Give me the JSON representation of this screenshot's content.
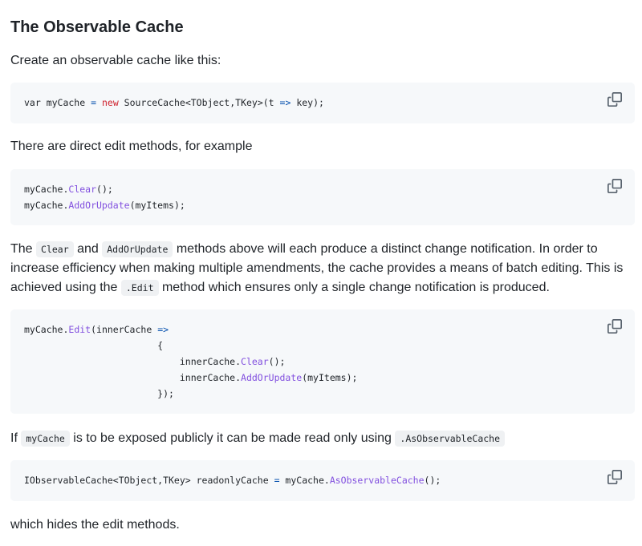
{
  "heading": "The Observable Cache",
  "p1": "Create an observable cache like this:",
  "p2": "There are direct edit methods, for example",
  "p3": {
    "t1": "The ",
    "c1": "Clear",
    "t2": " and ",
    "c2": "AddOrUpdate",
    "t3": " methods above will each produce a distinct change notification. In order to increase efficiency when making multiple amendments, the cache provides a means of batch editing. This is achieved using the ",
    "c3": ".Edit",
    "t4": " method which ensures only a single change notification is produced."
  },
  "p4": {
    "t1": "If ",
    "c1": "myCache",
    "t2": " is to be exposed publicly it can be made read only using ",
    "c2": ".AsObservableCache"
  },
  "p5": "which hides the edit methods.",
  "code1": {
    "l1": {
      "a": "var myCache ",
      "b": "=",
      "c": " ",
      "d": "new",
      "e": " SourceCache<TObject,TKey>(t ",
      "f": "=>",
      "g": " key);"
    }
  },
  "code2": {
    "l1": {
      "a": "myCache.",
      "b": "Clear",
      "c": "();"
    },
    "l2": {
      "a": "myCache.",
      "b": "AddOrUpdate",
      "c": "(myItems);"
    }
  },
  "code3": {
    "l1": {
      "a": "myCache.",
      "b": "Edit",
      "c": "(innerCache ",
      "d": "=>"
    },
    "l2": "                        {",
    "l3": {
      "a": "                            innerCache.",
      "b": "Clear",
      "c": "();"
    },
    "l4": {
      "a": "                            innerCache.",
      "b": "AddOrUpdate",
      "c": "(myItems);"
    },
    "l5": "                        });"
  },
  "code4": {
    "l1": {
      "a": "IObservableCache<TObject,TKey> readonlyCache ",
      "b": "=",
      "c": " myCache.",
      "d": "AsObservableCache",
      "e": "();"
    }
  },
  "colors": {
    "keyword": "#cf222e",
    "method": "#8250df",
    "operator": "#0550ae",
    "code_bg": "#f6f8fa"
  },
  "icons": {
    "copy": "copy-icon"
  }
}
